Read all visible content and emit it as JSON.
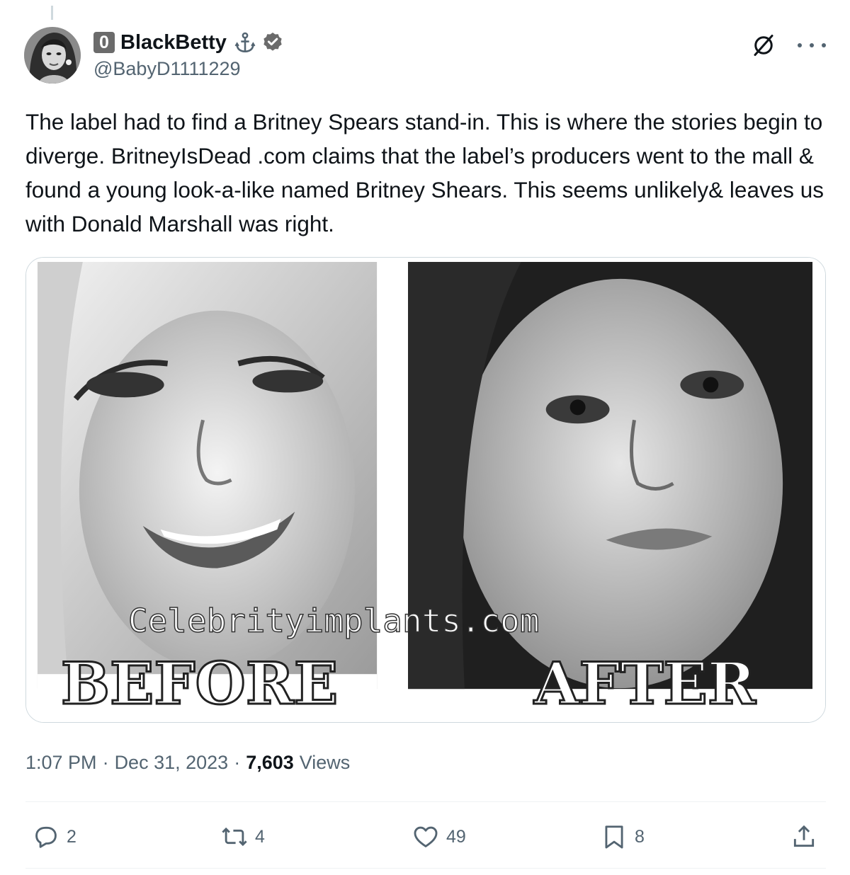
{
  "tweet": {
    "author": {
      "badge": "0",
      "display_name": "BlackBetty",
      "handle": "@BabyD1111229"
    },
    "text": "The label had to find a Britney Spears stand-in. This is where the stories begin to diverge. BritneyIsDead .com claims that the label’s producers went to the mall & found a young look-a-like named Britney Shears. This seems unlikely& leaves us with Donald Marshall was right.",
    "media": {
      "watermark": "Celebrityimplants.com",
      "label_before": "BEFORE",
      "label_after": "AFTER"
    },
    "meta": {
      "time": "1:07 PM",
      "separator": "·",
      "date": "Dec 31, 2023",
      "views_count": "7,603",
      "views_label": "Views"
    },
    "actions": {
      "replies": "2",
      "reposts": "4",
      "likes": "49",
      "bookmarks": "8"
    }
  },
  "icons": {
    "header": [
      "anchor-icon",
      "verified-icon",
      "grok-icon",
      "more-icon"
    ],
    "actions": [
      "reply-icon",
      "repost-icon",
      "like-icon",
      "bookmark-icon",
      "share-icon"
    ]
  },
  "colors": {
    "text_primary": "#0f1419",
    "text_secondary": "#536471",
    "border": "#cfd9de",
    "divider": "#eff3f4",
    "badge_bg": "#6b6b6b"
  }
}
